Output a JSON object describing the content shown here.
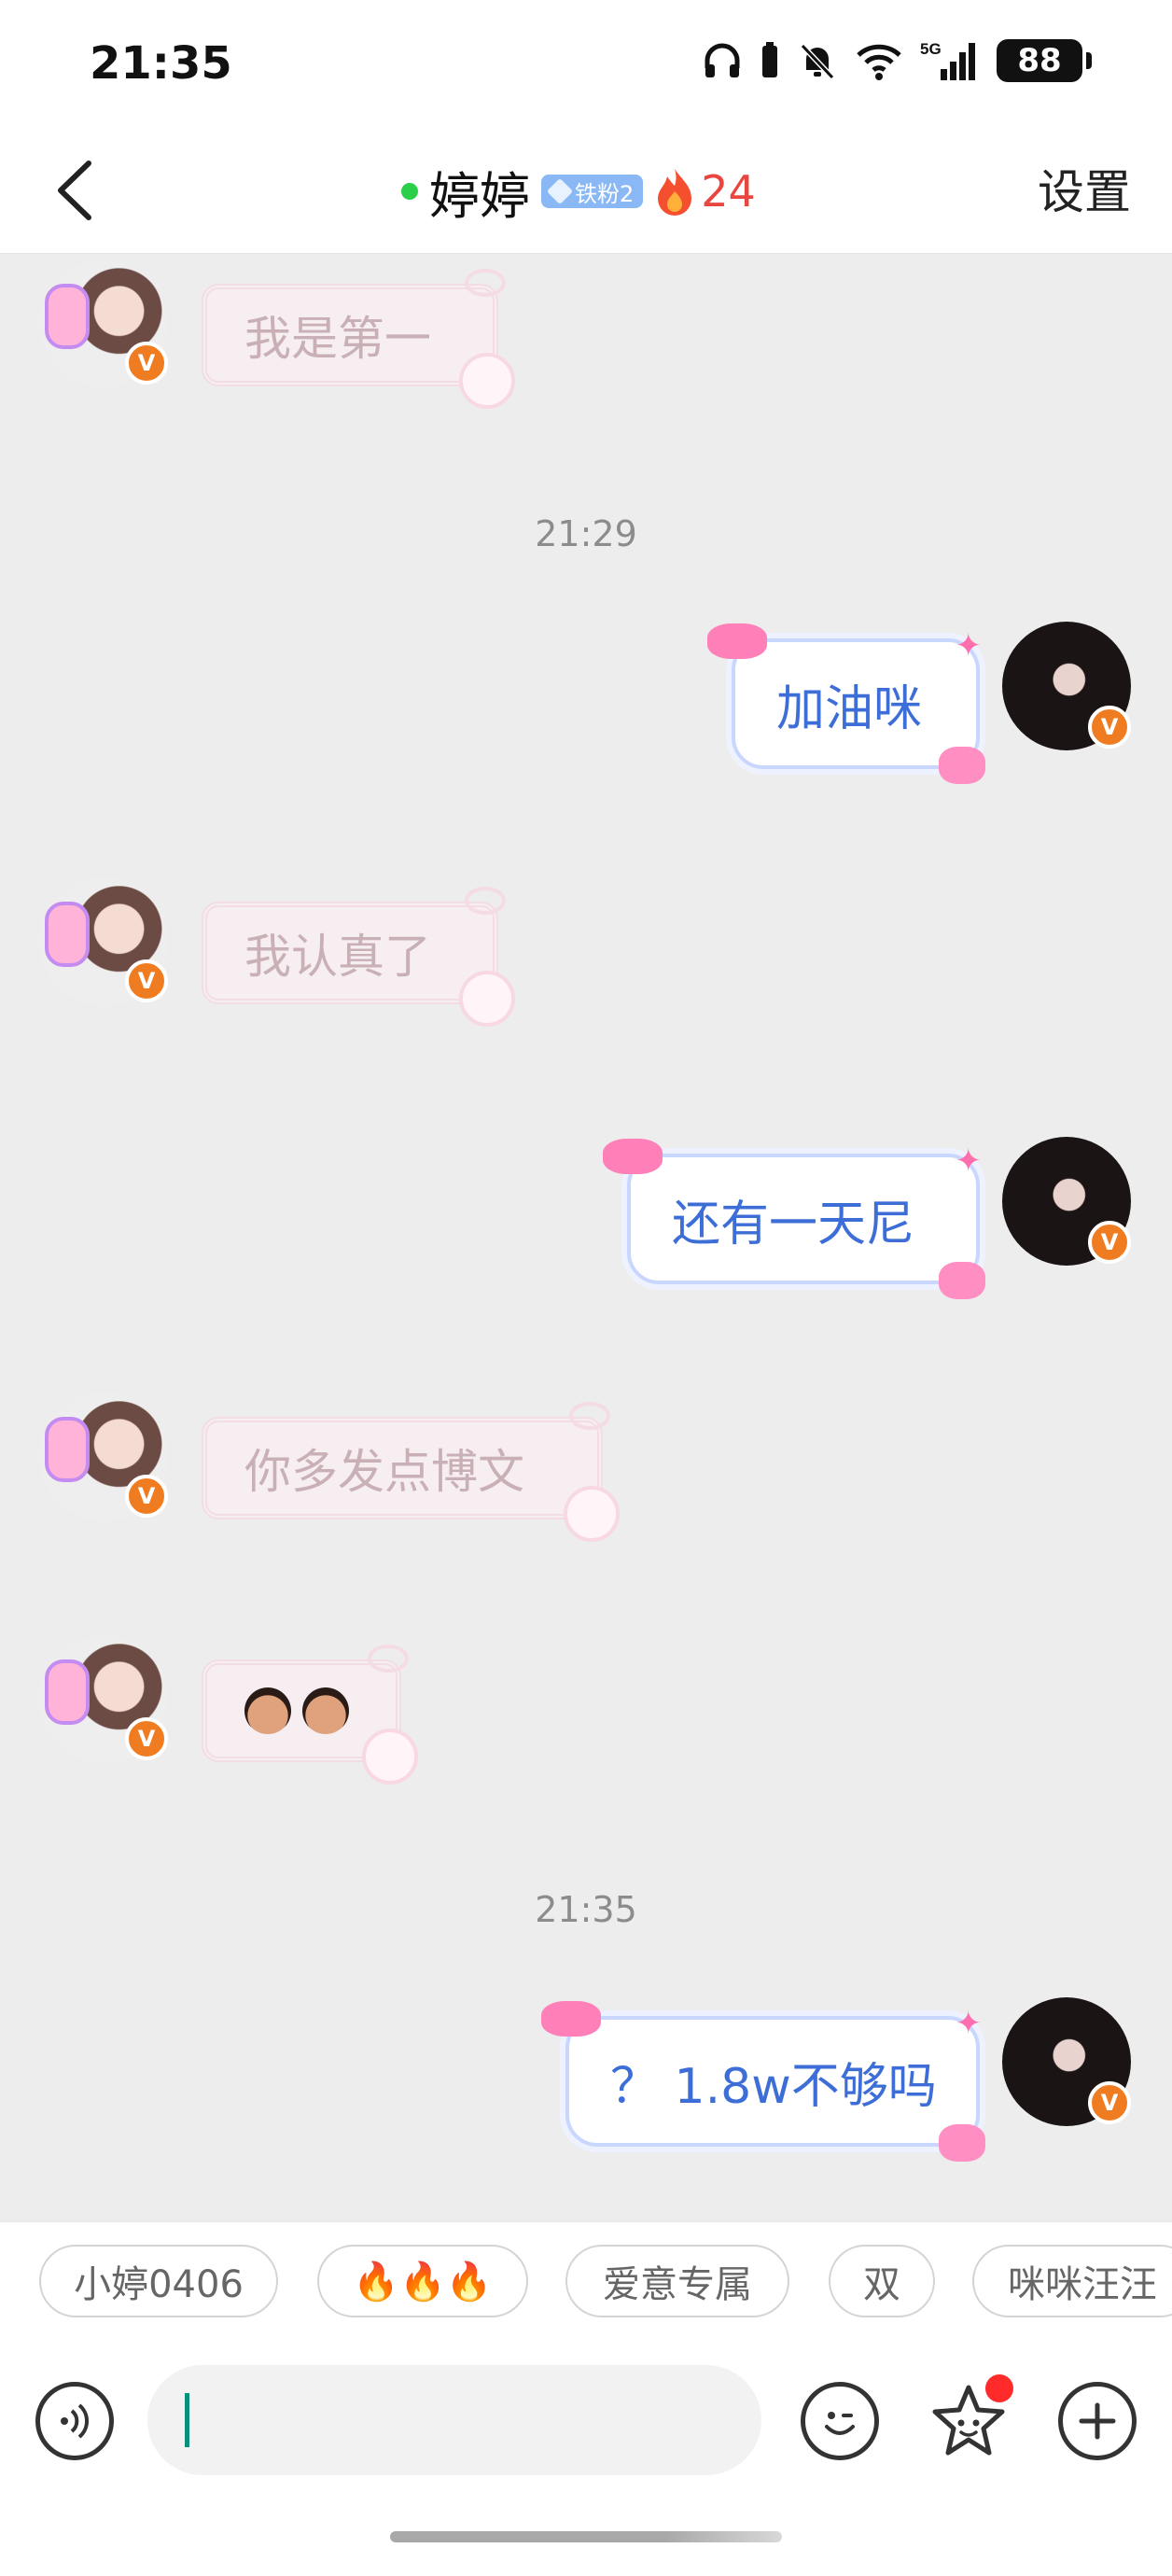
{
  "status_bar": {
    "time": "21:35",
    "battery": "88"
  },
  "header": {
    "name": "婷婷",
    "fan_badge": "铁粉2",
    "fire_count": "24",
    "settings_label": "设置"
  },
  "messages": [
    {
      "from": "other",
      "text": "我是第一"
    },
    {
      "timestamp": "21:29"
    },
    {
      "from": "self",
      "text": "加油咪"
    },
    {
      "from": "other",
      "text": "我认真了"
    },
    {
      "from": "self",
      "text": "还有一天尼"
    },
    {
      "from": "other",
      "text": "你多发点博文"
    },
    {
      "from": "other",
      "type": "sticker"
    },
    {
      "timestamp": "21:35"
    },
    {
      "from": "self",
      "text": "？ 1.8w不够吗"
    }
  ],
  "quick_replies": [
    "小婷0406",
    "🔥🔥🔥",
    "爱意专属",
    "双",
    "咪咪汪汪"
  ],
  "colors": {
    "accent_blue": "#3d6ed8",
    "online_green": "#2ccf4a",
    "fire_red": "#e8463f",
    "verified_orange": "#f07c22",
    "chat_bg": "#ededed"
  },
  "icons": [
    "back-arrow-icon",
    "voice-icon",
    "emoji-icon",
    "star-face-icon",
    "plus-icon"
  ]
}
